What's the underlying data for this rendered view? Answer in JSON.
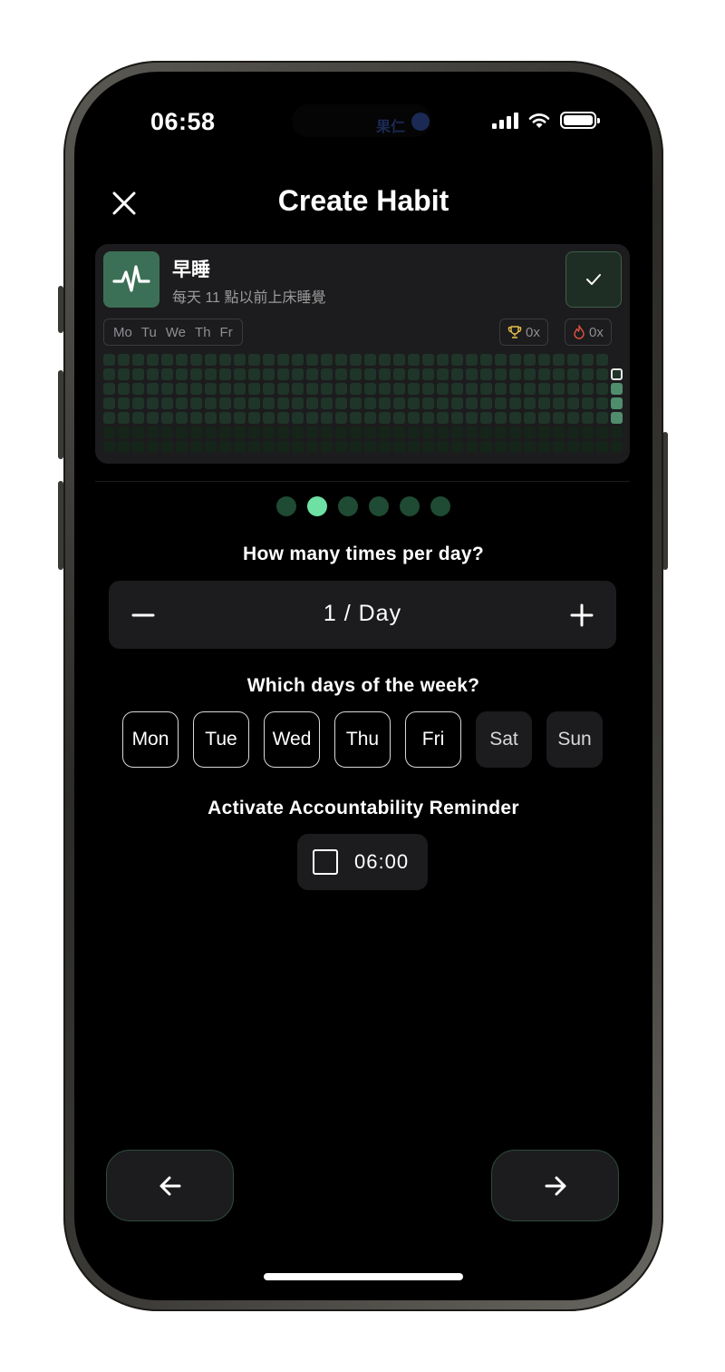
{
  "status_bar": {
    "time": "06:58",
    "island_text": "果仁"
  },
  "header": {
    "title": "Create Habit",
    "close_icon": "close-icon"
  },
  "habit_card": {
    "icon": "pulse-icon",
    "name": "早睡",
    "description": "每天 11 點以前上床睡覺",
    "check_icon": "check-icon",
    "days": [
      "Mo",
      "Tu",
      "We",
      "Th",
      "Fr"
    ],
    "trophy_count": "0x",
    "streak_count": "0x",
    "colors": {
      "accent": "#3c7056",
      "grid_empty": "#1f3529",
      "grid_today": "#4f8d6c"
    }
  },
  "pager": {
    "total": 6,
    "active_index": 1,
    "active_color": "#6fe0a3",
    "inactive_color": "#1f4a33"
  },
  "frequency": {
    "question": "How many times per day?",
    "value": "1 / Day",
    "minus_icon": "minus-icon",
    "plus_icon": "plus-icon"
  },
  "weekdays": {
    "question": "Which days of the week?",
    "items": [
      {
        "label": "Mon",
        "selected": true
      },
      {
        "label": "Tue",
        "selected": true
      },
      {
        "label": "Wed",
        "selected": true
      },
      {
        "label": "Thu",
        "selected": true
      },
      {
        "label": "Fri",
        "selected": true
      },
      {
        "label": "Sat",
        "selected": false
      },
      {
        "label": "Sun",
        "selected": false
      }
    ]
  },
  "reminder": {
    "question": "Activate Accountability Reminder",
    "time": "06:00",
    "checked": false
  },
  "navigation": {
    "back_icon": "arrow-left-icon",
    "next_icon": "arrow-right-icon"
  }
}
